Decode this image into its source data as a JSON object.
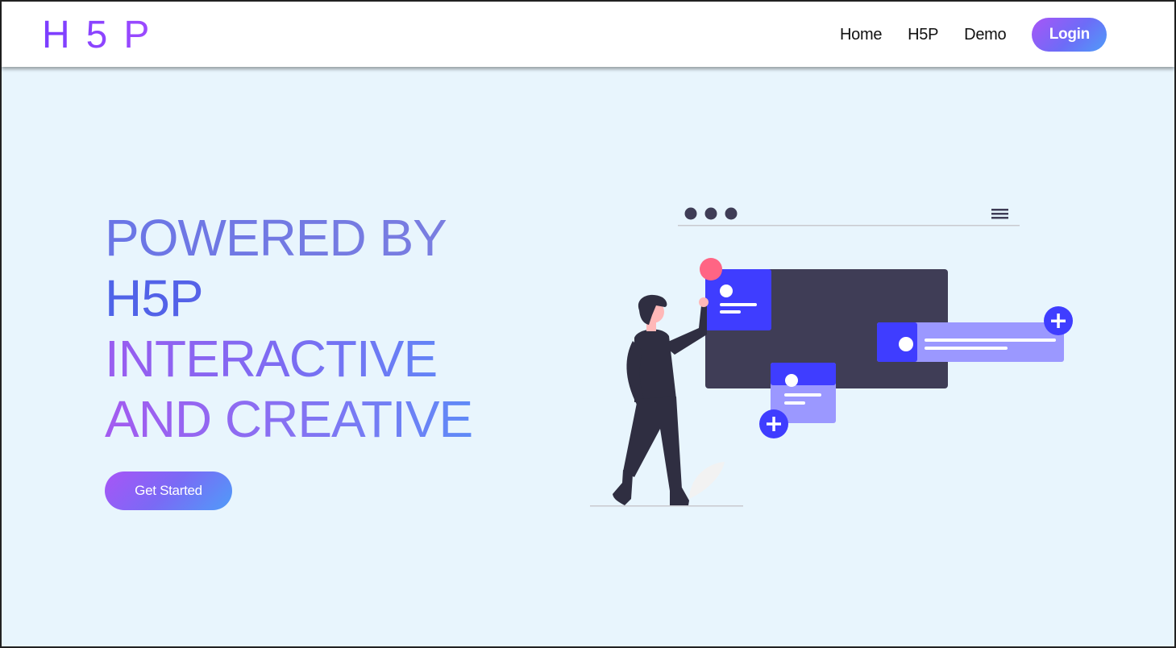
{
  "nav": {
    "logo": "H5P",
    "links": [
      "Home",
      "H5P",
      "Demo"
    ],
    "login_label": "Login"
  },
  "hero": {
    "lines": [
      "POWERED BY",
      "H5P",
      "INTERACTIVE",
      "AND CREATIVE"
    ],
    "cta_label": "Get Started"
  },
  "colors": {
    "background": "#e8f5fd",
    "accent_purple": "#a855f7",
    "accent_blue": "#4f9cf9",
    "illustration_card": "#3f3d56",
    "illustration_blue": "#3f3dff",
    "illustration_pink": "#ff6584"
  },
  "illustration": {
    "window_menu_icon": "hamburger-icon",
    "plus_icon": "plus-icon"
  }
}
